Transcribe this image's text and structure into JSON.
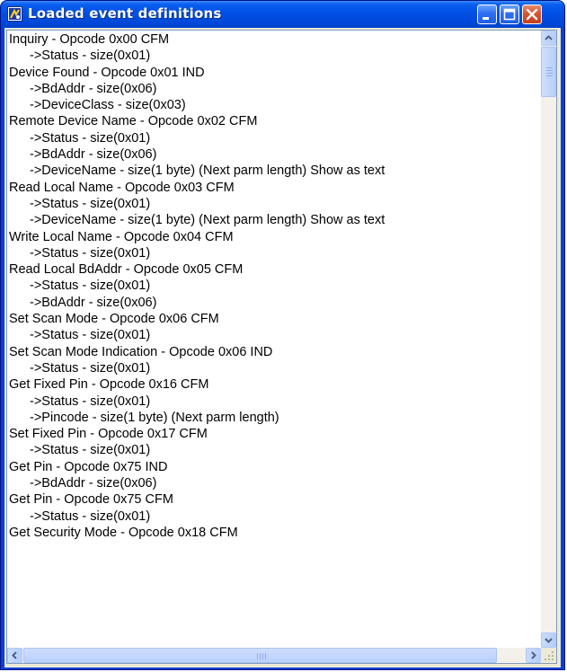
{
  "window": {
    "title": "Loaded event definitions",
    "icon": "app-window-icon",
    "controls": {
      "minimize_icon": "minimize-icon",
      "maximize_icon": "maximize-icon",
      "close_icon": "close-icon"
    }
  },
  "colors": {
    "titlebar": "#0251e6",
    "close_button": "#d9542f",
    "client_background": "#ece9d8",
    "list_background": "#ffffff",
    "text": "#000000"
  },
  "event_list": {
    "lines": [
      {
        "text": "Inquiry - Opcode 0x00 CFM",
        "indent": false
      },
      {
        "text": "->Status - size(0x01)",
        "indent": true
      },
      {
        "text": "Device Found - Opcode 0x01 IND",
        "indent": false
      },
      {
        "text": "->BdAddr - size(0x06)",
        "indent": true
      },
      {
        "text": "->DeviceClass - size(0x03)",
        "indent": true
      },
      {
        "text": "Remote Device Name - Opcode 0x02 CFM",
        "indent": false
      },
      {
        "text": "->Status - size(0x01)",
        "indent": true
      },
      {
        "text": "->BdAddr - size(0x06)",
        "indent": true
      },
      {
        "text": "->DeviceName - size(1 byte) (Next parm length)  Show as text",
        "indent": true
      },
      {
        "text": "Read Local Name - Opcode 0x03 CFM",
        "indent": false
      },
      {
        "text": "->Status - size(0x01)",
        "indent": true
      },
      {
        "text": "->DeviceName - size(1 byte) (Next parm length)  Show as text",
        "indent": true
      },
      {
        "text": "Write Local Name - Opcode 0x04 CFM",
        "indent": false
      },
      {
        "text": "->Status - size(0x01)",
        "indent": true
      },
      {
        "text": "Read Local BdAddr - Opcode 0x05 CFM",
        "indent": false
      },
      {
        "text": "->Status - size(0x01)",
        "indent": true
      },
      {
        "text": "->BdAddr - size(0x06)",
        "indent": true
      },
      {
        "text": "Set Scan Mode - Opcode 0x06 CFM",
        "indent": false
      },
      {
        "text": "->Status - size(0x01)",
        "indent": true
      },
      {
        "text": "Set Scan Mode Indication - Opcode 0x06 IND",
        "indent": false
      },
      {
        "text": "->Status - size(0x01)",
        "indent": true
      },
      {
        "text": "Get Fixed Pin - Opcode 0x16 CFM",
        "indent": false
      },
      {
        "text": "->Status - size(0x01)",
        "indent": true
      },
      {
        "text": "->Pincode - size(1 byte) (Next parm length)",
        "indent": true
      },
      {
        "text": "Set Fixed Pin - Opcode 0x17 CFM",
        "indent": false
      },
      {
        "text": "->Status - size(0x01)",
        "indent": true
      },
      {
        "text": "Get Pin - Opcode 0x75 IND",
        "indent": false
      },
      {
        "text": "->BdAddr - size(0x06)",
        "indent": true
      },
      {
        "text": "Get Pin - Opcode 0x75 CFM",
        "indent": false
      },
      {
        "text": "->Status - size(0x01)",
        "indent": true
      },
      {
        "text": "Get Security Mode - Opcode 0x18 CFM",
        "indent": false
      }
    ]
  },
  "scrollbars": {
    "vertical": {
      "up_icon": "scroll-up-arrow-icon",
      "down_icon": "scroll-down-arrow-icon"
    },
    "horizontal": {
      "left_icon": "scroll-left-arrow-icon",
      "right_icon": "scroll-right-arrow-icon"
    },
    "resize_grip_icon": "resize-grip-icon"
  }
}
